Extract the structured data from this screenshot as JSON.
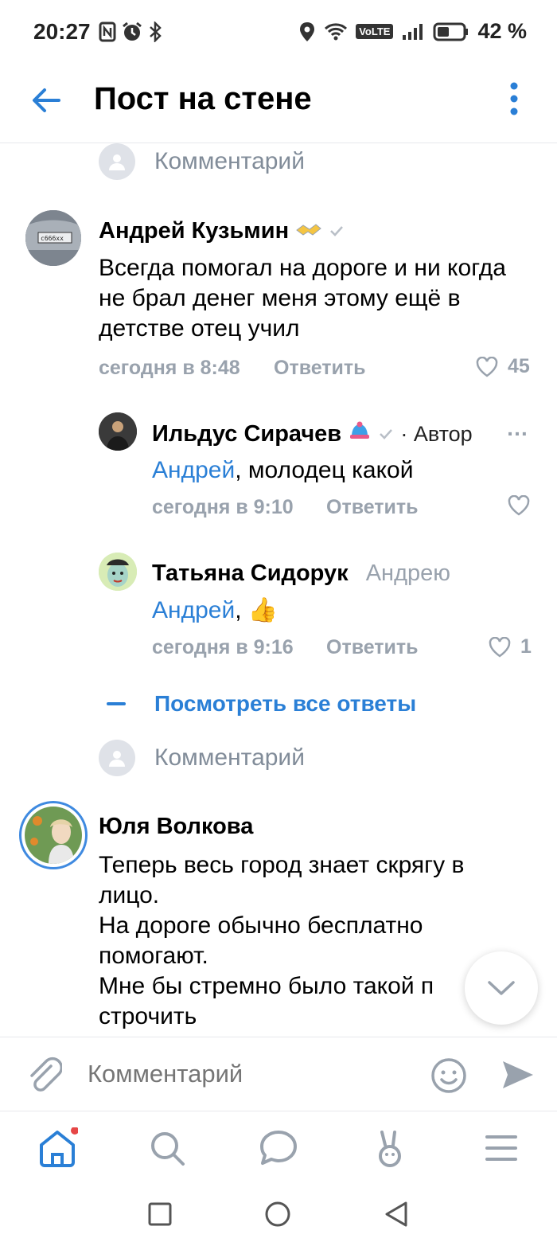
{
  "status_bar": {
    "time": "20:27",
    "battery_pct": "42 %",
    "volte": "VoLTE"
  },
  "header": {
    "title": "Пост на стене"
  },
  "comment_placeholder": "Комментарий",
  "comments": [
    {
      "author": "Андрей Кузьмин",
      "text": "Всегда помогал на дороге и ни когда не брал денег меня этому ещё в детстве отец учил",
      "time": "сегодня в 8:48",
      "reply_label": "Ответить",
      "likes": "45"
    },
    {
      "author": "Ильдус Сирачев",
      "author_tag": "· Автор",
      "mention": "Андрей",
      "text": ", молодец какой",
      "time": "сегодня в 9:10",
      "reply_label": "Ответить",
      "more": "…"
    },
    {
      "author": "Татьяна Сидорук",
      "reply_to": "Андрею",
      "mention": "Андрей",
      "text": ", 👍",
      "time": "сегодня в 9:16",
      "reply_label": "Ответить",
      "likes": "1"
    },
    {
      "author": "Юля Волкова",
      "text_lines": [
        "Теперь весь город знает скрягу в",
        "лицо.",
        "На дороге обычно бесплатно",
        "помогают.",
        "Мне бы стремно было такой п",
        "строчить"
      ]
    }
  ],
  "see_all_replies": "Посмотреть все ответы",
  "compose": {
    "placeholder": "Комментарий"
  },
  "colors": {
    "accent": "#2a7fd6",
    "muted": "#99a2ad",
    "placeholder": "#818c99"
  }
}
